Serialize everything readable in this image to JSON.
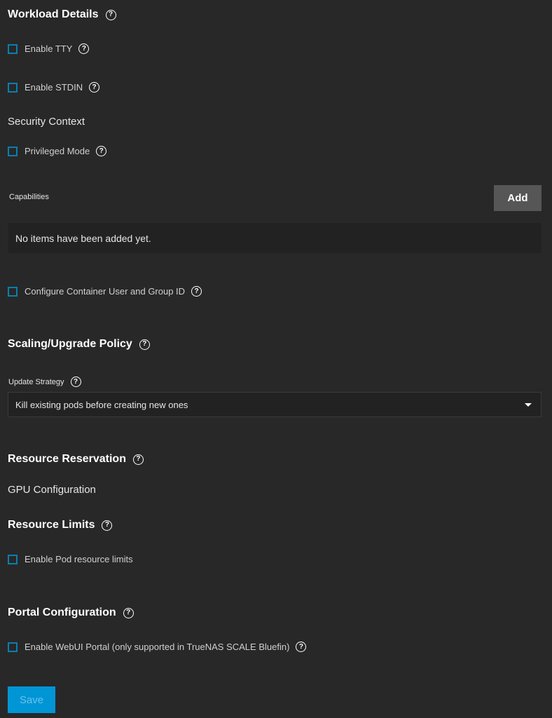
{
  "workload": {
    "title": "Workload Details",
    "enable_tty": "Enable TTY",
    "enable_stdin": "Enable STDIN"
  },
  "security": {
    "title": "Security Context",
    "privileged": "Privileged Mode",
    "capabilities_label": "Capabilities",
    "add_label": "Add",
    "empty_text": "No items have been added yet.",
    "configure_ids": "Configure Container User and Group ID"
  },
  "scaling": {
    "title": "Scaling/Upgrade Policy",
    "update_strategy_label": "Update Strategy",
    "update_strategy_value": "Kill existing pods before creating new ones"
  },
  "resources": {
    "reservation_title": "Resource Reservation",
    "gpu_title": "GPU Configuration",
    "limits_title": "Resource Limits",
    "enable_limits": "Enable Pod resource limits"
  },
  "portal": {
    "title": "Portal Configuration",
    "enable_webui": "Enable WebUI Portal (only supported in TrueNAS SCALE Bluefin)"
  },
  "save_label": "Save",
  "help_glyph": "?",
  "colors": {
    "background": "#282828",
    "accent": "#0095d5",
    "checkbox_border": "#0a7fb0"
  }
}
